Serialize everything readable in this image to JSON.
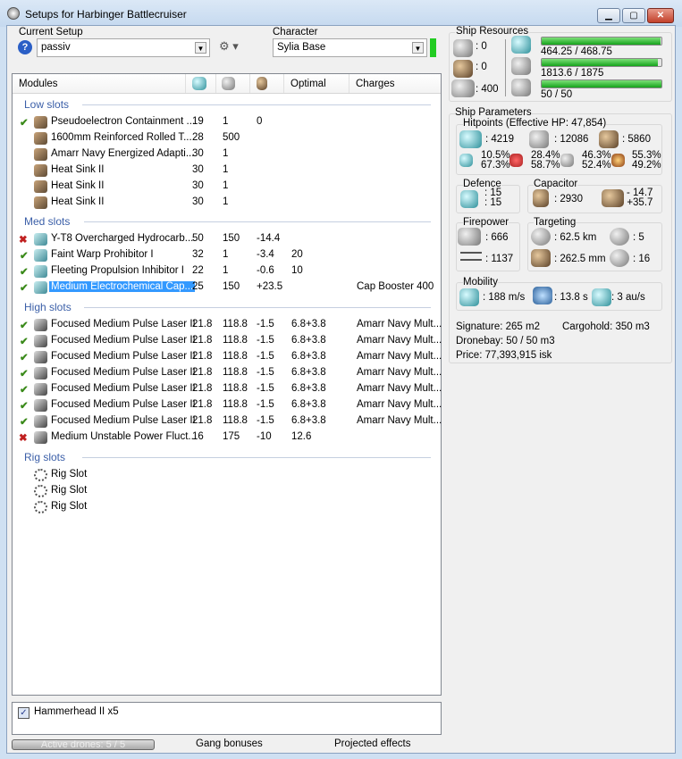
{
  "window": {
    "title": "Setups for Harbinger Battlecruiser",
    "minimize": "▁",
    "maximize": "▢",
    "close": "✕"
  },
  "setup": {
    "label": "Current Setup",
    "value": "passiv",
    "help": "?"
  },
  "character": {
    "label": "Character",
    "value": "Sylia Base",
    "status_color": "#22cc22"
  },
  "modules": {
    "headers": {
      "name": "Modules",
      "optimal": "Optimal",
      "charges": "Charges"
    },
    "groups": [
      {
        "title": "Low slots",
        "rows": [
          {
            "state": "on",
            "name": "Pseudoelectron Containment ...",
            "cpu": "19",
            "pg": "1",
            "cap": "0",
            "optimal": "",
            "charges": ""
          },
          {
            "state": "",
            "name": "1600mm Reinforced Rolled T...",
            "cpu": "28",
            "pg": "500",
            "cap": "",
            "optimal": "",
            "charges": ""
          },
          {
            "state": "",
            "name": "Amarr Navy Energized Adapti...",
            "cpu": "30",
            "pg": "1",
            "cap": "",
            "optimal": "",
            "charges": ""
          },
          {
            "state": "",
            "name": "Heat Sink II",
            "cpu": "30",
            "pg": "1",
            "cap": "",
            "optimal": "",
            "charges": ""
          },
          {
            "state": "",
            "name": "Heat Sink II",
            "cpu": "30",
            "pg": "1",
            "cap": "",
            "optimal": "",
            "charges": ""
          },
          {
            "state": "",
            "name": "Heat Sink II",
            "cpu": "30",
            "pg": "1",
            "cap": "",
            "optimal": "",
            "charges": ""
          }
        ]
      },
      {
        "title": "Med slots",
        "rows": [
          {
            "state": "off",
            "name": "Y-T8 Overcharged Hydrocarb...",
            "cpu": "50",
            "pg": "150",
            "cap": "-14.4",
            "optimal": "",
            "charges": ""
          },
          {
            "state": "on",
            "name": "Faint Warp Prohibitor I",
            "cpu": "32",
            "pg": "1",
            "cap": "-3.4",
            "optimal": "20",
            "charges": ""
          },
          {
            "state": "on",
            "name": "Fleeting Propulsion Inhibitor I",
            "cpu": "22",
            "pg": "1",
            "cap": "-0.6",
            "optimal": "10",
            "charges": ""
          },
          {
            "state": "on",
            "name": "Medium Electrochemical Cap...",
            "cpu": "25",
            "pg": "150",
            "cap": "+23.5",
            "optimal": "",
            "charges": "Cap Booster 400",
            "selected": true
          }
        ]
      },
      {
        "title": "High slots",
        "rows": [
          {
            "state": "on",
            "name": "Focused Medium Pulse Laser II",
            "cpu": "21.8",
            "pg": "118.8",
            "cap": "-1.5",
            "optimal": "6.8+3.8",
            "charges": "Amarr Navy Mult..."
          },
          {
            "state": "on",
            "name": "Focused Medium Pulse Laser II",
            "cpu": "21.8",
            "pg": "118.8",
            "cap": "-1.5",
            "optimal": "6.8+3.8",
            "charges": "Amarr Navy Mult..."
          },
          {
            "state": "on",
            "name": "Focused Medium Pulse Laser II",
            "cpu": "21.8",
            "pg": "118.8",
            "cap": "-1.5",
            "optimal": "6.8+3.8",
            "charges": "Amarr Navy Mult..."
          },
          {
            "state": "on",
            "name": "Focused Medium Pulse Laser II",
            "cpu": "21.8",
            "pg": "118.8",
            "cap": "-1.5",
            "optimal": "6.8+3.8",
            "charges": "Amarr Navy Mult..."
          },
          {
            "state": "on",
            "name": "Focused Medium Pulse Laser II",
            "cpu": "21.8",
            "pg": "118.8",
            "cap": "-1.5",
            "optimal": "6.8+3.8",
            "charges": "Amarr Navy Mult..."
          },
          {
            "state": "on",
            "name": "Focused Medium Pulse Laser II",
            "cpu": "21.8",
            "pg": "118.8",
            "cap": "-1.5",
            "optimal": "6.8+3.8",
            "charges": "Amarr Navy Mult..."
          },
          {
            "state": "on",
            "name": "Focused Medium Pulse Laser II",
            "cpu": "21.8",
            "pg": "118.8",
            "cap": "-1.5",
            "optimal": "6.8+3.8",
            "charges": "Amarr Navy Mult..."
          },
          {
            "state": "off",
            "name": "Medium Unstable Power Fluct...",
            "cpu": "16",
            "pg": "175",
            "cap": "-10",
            "optimal": "12.6",
            "charges": ""
          }
        ]
      },
      {
        "title": "Rig slots",
        "rows": [
          {
            "state": "",
            "name": "Rig Slot",
            "cpu": "",
            "pg": "",
            "cap": "",
            "optimal": "",
            "charges": "",
            "rig": true
          },
          {
            "state": "",
            "name": "Rig Slot",
            "cpu": "",
            "pg": "",
            "cap": "",
            "optimal": "",
            "charges": "",
            "rig": true
          },
          {
            "state": "",
            "name": "Rig Slot",
            "cpu": "",
            "pg": "",
            "cap": "",
            "optimal": "",
            "charges": "",
            "rig": true
          }
        ]
      }
    ]
  },
  "drones": {
    "item": "Hammerhead II x5",
    "checked": true
  },
  "bottom": {
    "active_drones": "Active drones: 5 / 5",
    "gang": "Gang bonuses",
    "projected": "Projected effects"
  },
  "resources": {
    "title": "Ship Resources",
    "turrets": ": 0",
    "launchers": ": 0",
    "calibration": ": 400",
    "cpu": "464.25 / 468.75",
    "cpu_frac": 0.99,
    "pg": "1813.6 / 1875",
    "pg_frac": 0.967,
    "drone_bw": "50 / 50",
    "drone_frac": 1.0
  },
  "params": {
    "title": "Ship Parameters",
    "hp_title": "Hitpoints (Effective HP: 47,854)",
    "shield": ": 4219",
    "armor": ": 12086",
    "hull": ": 5860",
    "resists": [
      [
        "10.5%",
        "67.3%"
      ],
      [
        "28.4%",
        "58.7%"
      ],
      [
        "46.3%",
        "52.4%"
      ],
      [
        "55.3%",
        "49.2%"
      ]
    ],
    "defence_title": "Defence",
    "def1": ": 15",
    "def2": ": 15",
    "capacitor_title": "Capacitor",
    "cap_amount": ": 2930",
    "cap_delta1": "- 14.7",
    "cap_delta2": "+35.7",
    "firepower_title": "Firepower",
    "dps": ": 666",
    "volley": ": 1137",
    "targeting_title": "Targeting",
    "range": ": 62.5 km",
    "targets": ": 5",
    "scan_res": ": 262.5 mm",
    "sensor": ": 16",
    "mobility_title": "Mobility",
    "speed": ": 188 m/s",
    "align": ": 13.8 s",
    "warp": ": 3 au/s",
    "signature": "Signature: 265 m2",
    "cargo": "Cargohold: 350 m3",
    "dronebay": "Dronebay: 50 / 50 m3",
    "price": "Price: 77,393,915 isk"
  }
}
